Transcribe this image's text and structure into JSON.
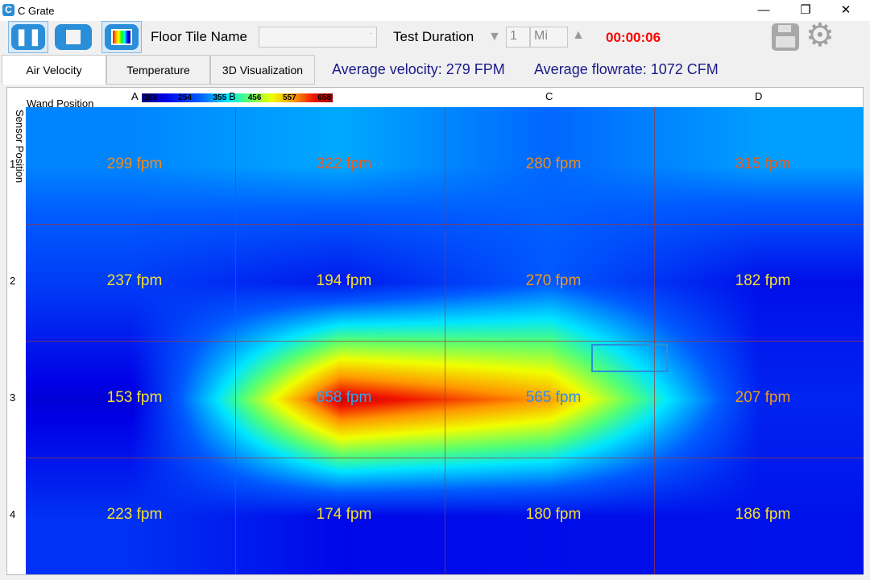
{
  "window": {
    "title": "C Grate",
    "app_icon_letter": "C"
  },
  "toolbar": {
    "floor_tile_label": "Floor Tile Name",
    "floor_tile_value": "",
    "test_duration_label": "Test Duration",
    "duration_value": "1",
    "duration_unit": "Mi",
    "timer": "00:00:06",
    "timer_color": "#ff0000"
  },
  "tabs": [
    {
      "label": "Air Velocity",
      "active": true
    },
    {
      "label": "Temperature"
    },
    {
      "label": "3D Visualization"
    }
  ],
  "stats": {
    "avg_velocity": "Average velocity: 279 FPM",
    "avg_flowrate": "Average flowrate: 1072 CFM"
  },
  "chart_data": {
    "type": "heatmap",
    "xlabel": "Wand Position",
    "ylabel": "Sensor Position",
    "columns": [
      "A",
      "B",
      "C",
      "D"
    ],
    "rows": [
      "1",
      "2",
      "3",
      "4"
    ],
    "unit": "fpm",
    "values": [
      [
        299,
        322,
        280,
        315
      ],
      [
        237,
        194,
        270,
        182
      ],
      [
        153,
        658,
        565,
        207
      ],
      [
        223,
        174,
        180,
        186
      ]
    ],
    "label_colors": [
      [
        "#f08a18",
        "#f05a14",
        "#f08a18",
        "#f05a14"
      ],
      [
        "#f5e02a",
        "#f5e02a",
        "#f09a18",
        "#f5e02a"
      ],
      [
        "#f5e02a",
        "#2aa8f0",
        "#2a8ff0",
        "#f09a18"
      ],
      [
        "#f5e02a",
        "#f5e02a",
        "#f5e02a",
        "#f5e02a"
      ]
    ],
    "colorbar": {
      "ticks": [
        "153",
        "254",
        "355",
        "456",
        "557",
        "658"
      ],
      "min": 153,
      "max": 658
    }
  }
}
